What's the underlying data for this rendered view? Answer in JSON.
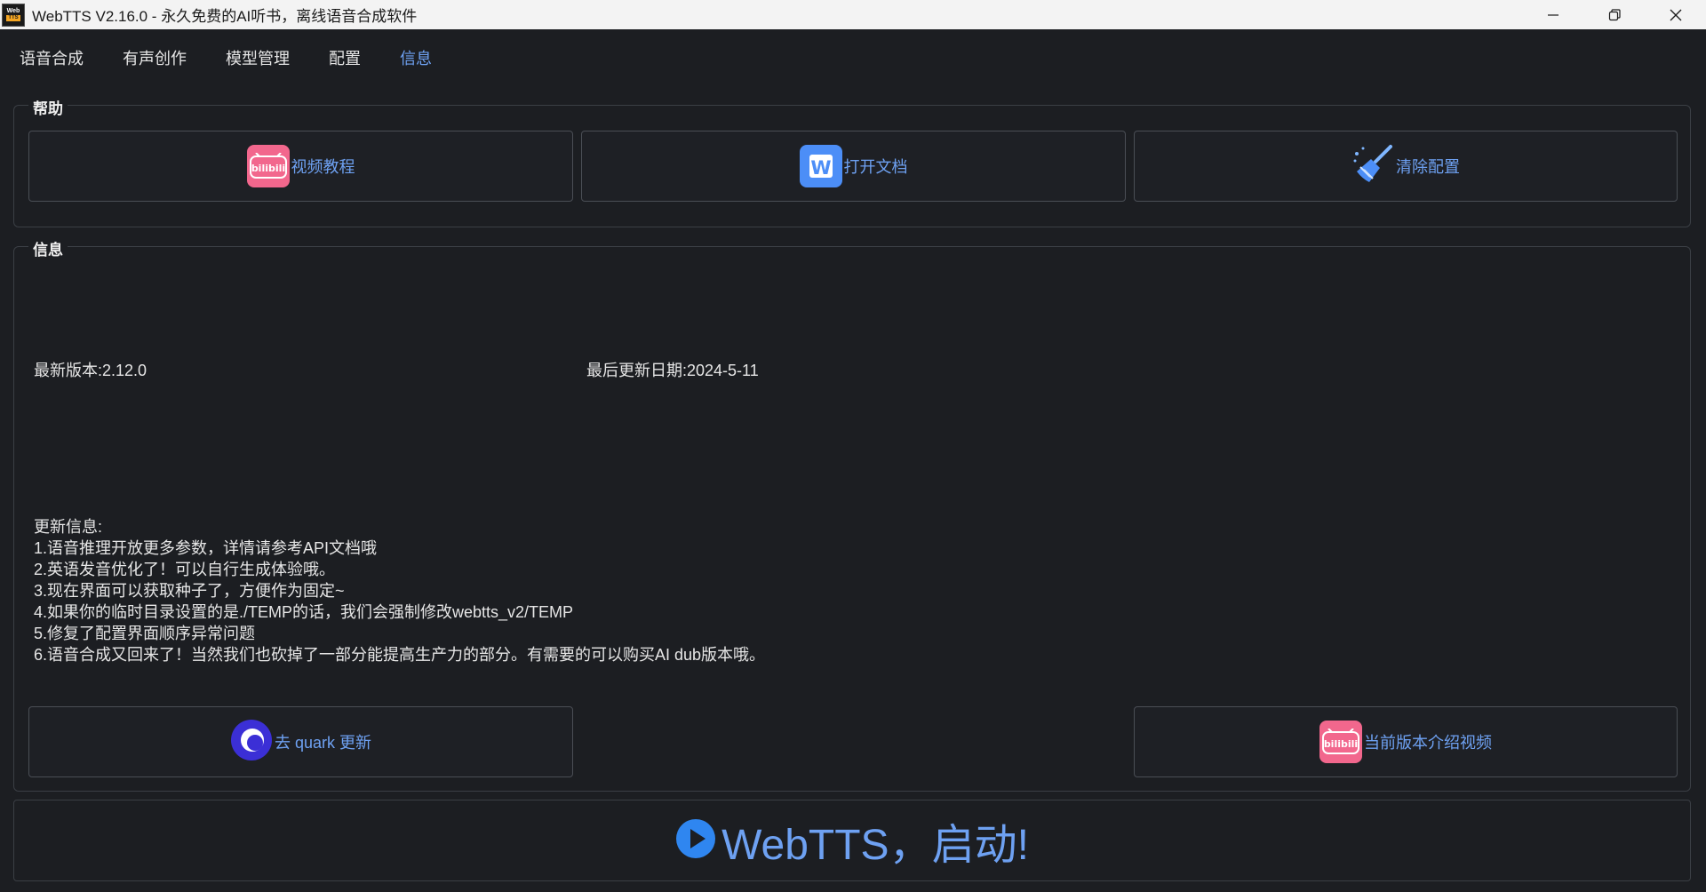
{
  "window": {
    "title": "WebTTS V2.16.0 - 永久免费的AI听书，离线语音合成软件",
    "icon_top": "Web",
    "icon_bottom": "TTS"
  },
  "tabs": [
    {
      "label": "语音合成"
    },
    {
      "label": "有声创作"
    },
    {
      "label": "模型管理"
    },
    {
      "label": "配置"
    },
    {
      "label": "信息",
      "active": true
    }
  ],
  "help": {
    "title": "帮助",
    "video_tutorial": "视频教程",
    "open_docs": "打开文档",
    "clear_config": "清除配置"
  },
  "info": {
    "title": "信息",
    "latest_version": "最新版本:2.12.0",
    "last_update": "最后更新日期:2024-5-11",
    "notes_heading": "更新信息:",
    "notes": [
      "1.语音推理开放更多参数，详情请参考API文档哦",
      "2.英语发音优化了！可以自行生成体验哦。",
      "3.现在界面可以获取种子了，方便作为固定~",
      "4.如果你的临时目录设置的是./TEMP的话，我们会强制修改webtts_v2/TEMP",
      "5.修复了配置界面顺序异常问题",
      "6.语音合成又回来了！当然我们也砍掉了一部分能提高生产力的部分。有需要的可以购买AI dub版本哦。"
    ],
    "quark_button": "去 quark 更新",
    "intro_video_button": "当前版本介绍视频"
  },
  "launch": {
    "label": "WebTTS，启动!"
  },
  "icons": {
    "bilibili_text": "bilibili",
    "wps_letter": "W"
  },
  "colors": {
    "accent": "#6ea1f2",
    "background": "#1c1e22",
    "bilibili": "#f2678d",
    "wps": "#4c8ef7",
    "quark": "#3b2fd6"
  }
}
